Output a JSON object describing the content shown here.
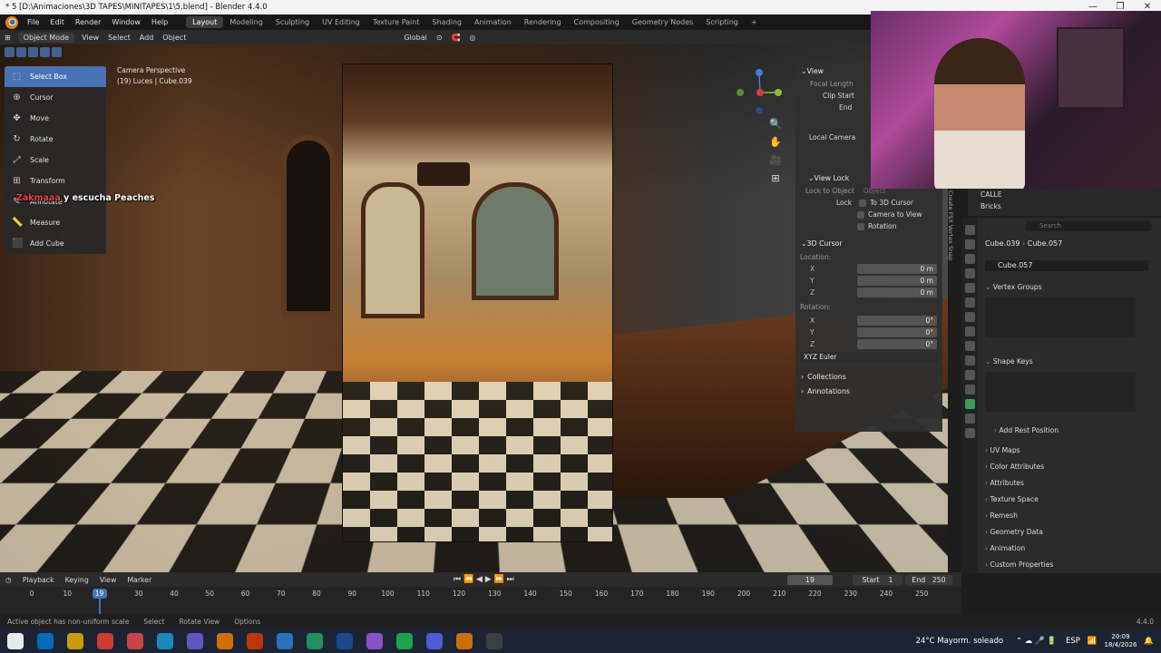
{
  "window": {
    "title": "* 5 [D:\\Animaciones\\3D TAPES\\MINITAPES\\1\\5.blend] - Blender 4.4.0",
    "controls": [
      "—",
      "❐",
      "✕"
    ]
  },
  "menu": {
    "items": [
      "File",
      "Edit",
      "Render",
      "Window",
      "Help"
    ],
    "workspaces": [
      "Layout",
      "Modeling",
      "Sculpting",
      "UV Editing",
      "Texture Paint",
      "Shading",
      "Animation",
      "Rendering",
      "Compositing",
      "Geometry Nodes",
      "Scripting"
    ],
    "active_workspace": "Layout",
    "add_tab": "+"
  },
  "viewport_header": {
    "mode": "Object Mode",
    "menus": [
      "View",
      "Select",
      "Add",
      "Object"
    ],
    "orientation": "Global"
  },
  "viewport": {
    "camera_label": "Camera Perspective",
    "object_label": "(19) Luces | Cube.039",
    "chat_name": "Zakmaaa",
    "chat_message": "y escucha Peaches"
  },
  "toolbar": {
    "tools": [
      {
        "label": "Select Box",
        "icon": "⬚"
      },
      {
        "label": "Cursor",
        "icon": "⊕"
      },
      {
        "label": "Move",
        "icon": "✥"
      },
      {
        "label": "Rotate",
        "icon": "↻"
      },
      {
        "label": "Scale",
        "icon": "⤢"
      },
      {
        "label": "Transform",
        "icon": "⊞"
      },
      {
        "label": "Annotate",
        "icon": "✎"
      },
      {
        "label": "Measure",
        "icon": "📏"
      },
      {
        "label": "Add Cube",
        "icon": "⬛"
      }
    ]
  },
  "npanel": {
    "view_title": "View",
    "focal_length": "Focal Length",
    "clip_start": "Clip Start",
    "clip_end": "End",
    "local_camera": "Local Camera",
    "view_lock_title": "View Lock",
    "lock_to_object": "Lock to Object",
    "lock_to_object_placeholder": "Object",
    "lock": "Lock",
    "to_3d_cursor": "To 3D Cursor",
    "camera_to_view": "Camera to View",
    "rotation_lock": "Rotation",
    "cursor_title": "3D Cursor",
    "location": "Location:",
    "loc": [
      {
        "axis": "X",
        "value": "0 m"
      },
      {
        "axis": "Y",
        "value": "0 m"
      },
      {
        "axis": "Z",
        "value": "0 m"
      }
    ],
    "rotation": "Rotation:",
    "rot": [
      {
        "axis": "X",
        "value": "0°"
      },
      {
        "axis": "Y",
        "value": "0°"
      },
      {
        "axis": "Z",
        "value": "0°"
      }
    ],
    "euler": "XYZ Euler",
    "collections": "Collections",
    "annotations": "Annotations",
    "side_tabs": "Create FSX Vertex Snap"
  },
  "outliner": {
    "rows": [
      "CALLE",
      "Bricks"
    ]
  },
  "properties": {
    "search_placeholder": "Search",
    "object_name": "Cube.039",
    "mesh_name": "Cube.057",
    "data_name": "Cube.057",
    "vertex_groups": "Vertex Groups",
    "shape_keys": "Shape Keys",
    "add_rest_position": "Add Rest Position",
    "panels": [
      "UV Maps",
      "Color Attributes",
      "Attributes",
      "Texture Space",
      "Remesh",
      "Geometry Data",
      "Animation",
      "Custom Properties"
    ]
  },
  "timeline": {
    "menus": [
      "Playback",
      "Keying",
      "View",
      "Marker"
    ],
    "current_frame": "19",
    "start_label": "Start",
    "start_value": "1",
    "end_label": "End",
    "end_value": "250",
    "ticks": [
      "0",
      "10",
      "19",
      "30",
      "40",
      "50",
      "60",
      "70",
      "80",
      "90",
      "100",
      "110",
      "120",
      "130",
      "140",
      "150",
      "160",
      "170",
      "180",
      "190",
      "200",
      "210",
      "220",
      "230",
      "240",
      "250"
    ]
  },
  "statusbar": {
    "warning": "Active object has non-uniform scale",
    "select": "Select",
    "rotate_view": "Rotate View",
    "options": "Options",
    "version": "4.4.0"
  },
  "taskbar": {
    "weather": "24°C  Mayorm. soleado",
    "lang": "ESP",
    "time": "20:09",
    "date": "18/4/2026",
    "app_colors": [
      "#ffffff",
      "#0078d4",
      "#e8b100",
      "#ea4335",
      "#e34a4a",
      "#1a9bd7",
      "#6e5dd8",
      "#f07d00",
      "#d83b01",
      "#2b7fd4",
      "#21a366",
      "#1f4e9c",
      "#9d5be0",
      "#1db954",
      "#5865f2",
      "#e87d0d",
      "#444444"
    ]
  }
}
